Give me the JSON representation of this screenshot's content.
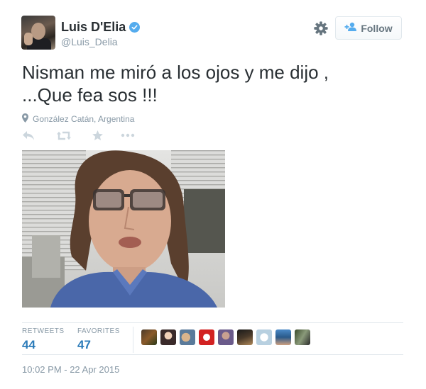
{
  "user": {
    "name": "Luis D'Elia",
    "handle": "@Luis_Delia",
    "verified_icon": "verified-badge-icon"
  },
  "header": {
    "settings_icon": "gear-icon",
    "follow_label": "Follow",
    "follow_icon": "add-user-icon"
  },
  "tweet": {
    "text_line1": "Nisman me miró a los ojos y me dijo ,",
    "text_line2": "...Que fea sos !!!",
    "location": "González Catán, Argentina",
    "timestamp": "10:02 PM - 22 Apr 2015"
  },
  "actions": [
    {
      "name": "reply",
      "icon": "reply-icon"
    },
    {
      "name": "retweet",
      "icon": "retweet-icon"
    },
    {
      "name": "favorite",
      "icon": "star-icon"
    },
    {
      "name": "more",
      "icon": "more-icon"
    }
  ],
  "stats": {
    "retweets_label": "RETWEETS",
    "retweets_count": "44",
    "favorites_label": "FAVORITES",
    "favorites_count": "47"
  },
  "favoriters_count_shown": 9,
  "colors": {
    "accent": "#55acee",
    "link": "#2b7bb9",
    "muted": "#8899a6",
    "text": "#292f33",
    "border": "#e1e8ed"
  }
}
